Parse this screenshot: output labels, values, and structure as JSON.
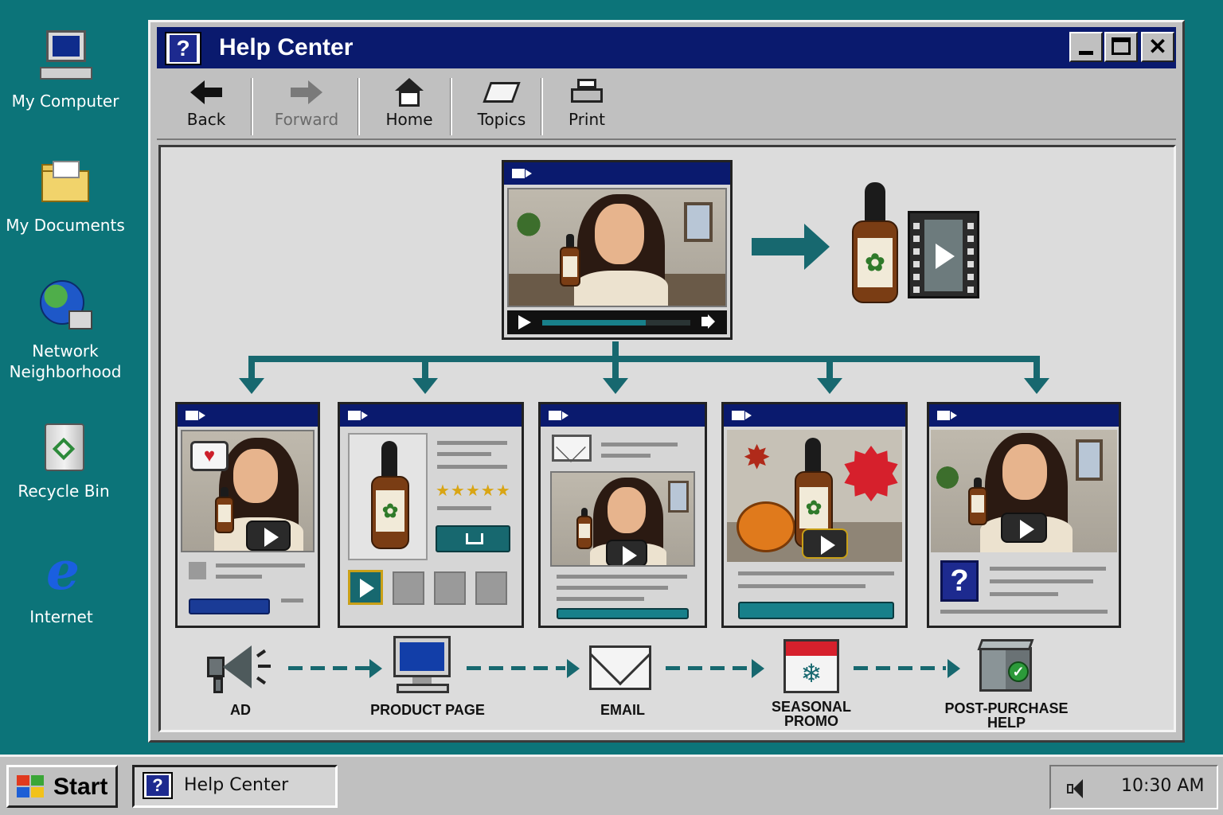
{
  "desktop": {
    "icons": [
      {
        "label": "My Computer",
        "icon": "computer-icon"
      },
      {
        "label": "My Documents",
        "icon": "folder-icon"
      },
      {
        "label": "Network\nNeighborhood",
        "icon": "network-globe-icon"
      },
      {
        "label": "Recycle Bin",
        "icon": "recycle-bin-icon"
      },
      {
        "label": "Internet",
        "icon": "internet-explorer-icon"
      }
    ]
  },
  "window": {
    "title": "Help Center",
    "toolbar": [
      {
        "label": "Back",
        "icon": "back-arrow-icon",
        "enabled": true
      },
      {
        "label": "Forward",
        "icon": "forward-arrow-icon",
        "enabled": false
      },
      {
        "label": "Home",
        "icon": "home-icon",
        "enabled": true
      },
      {
        "label": "Topics",
        "icon": "book-icon",
        "enabled": true
      },
      {
        "label": "Print",
        "icon": "printer-icon",
        "enabled": true
      }
    ]
  },
  "main_video": {
    "progress": 0.7
  },
  "product_card": {
    "rating_stars": 5,
    "stars_text": "★★★★★"
  },
  "steps": [
    {
      "label": "AD",
      "icon": "megaphone-icon"
    },
    {
      "label": "PRODUCT PAGE",
      "icon": "computer-monitor-icon"
    },
    {
      "label": "EMAIL",
      "icon": "envelope-icon"
    },
    {
      "label": "SEASONAL\nPROMO",
      "icon": "calendar-snowflake-icon"
    },
    {
      "label": "POST-PURCHASE\nHELP",
      "icon": "shipping-box-check-icon"
    }
  ],
  "taskbar": {
    "start_label": "Start",
    "task_label": "Help Center",
    "clock": "10:30 AM"
  },
  "colors": {
    "desktop": "#0c7479",
    "titlebar": "#0a1a6e",
    "flow_teal": "#17686f"
  }
}
